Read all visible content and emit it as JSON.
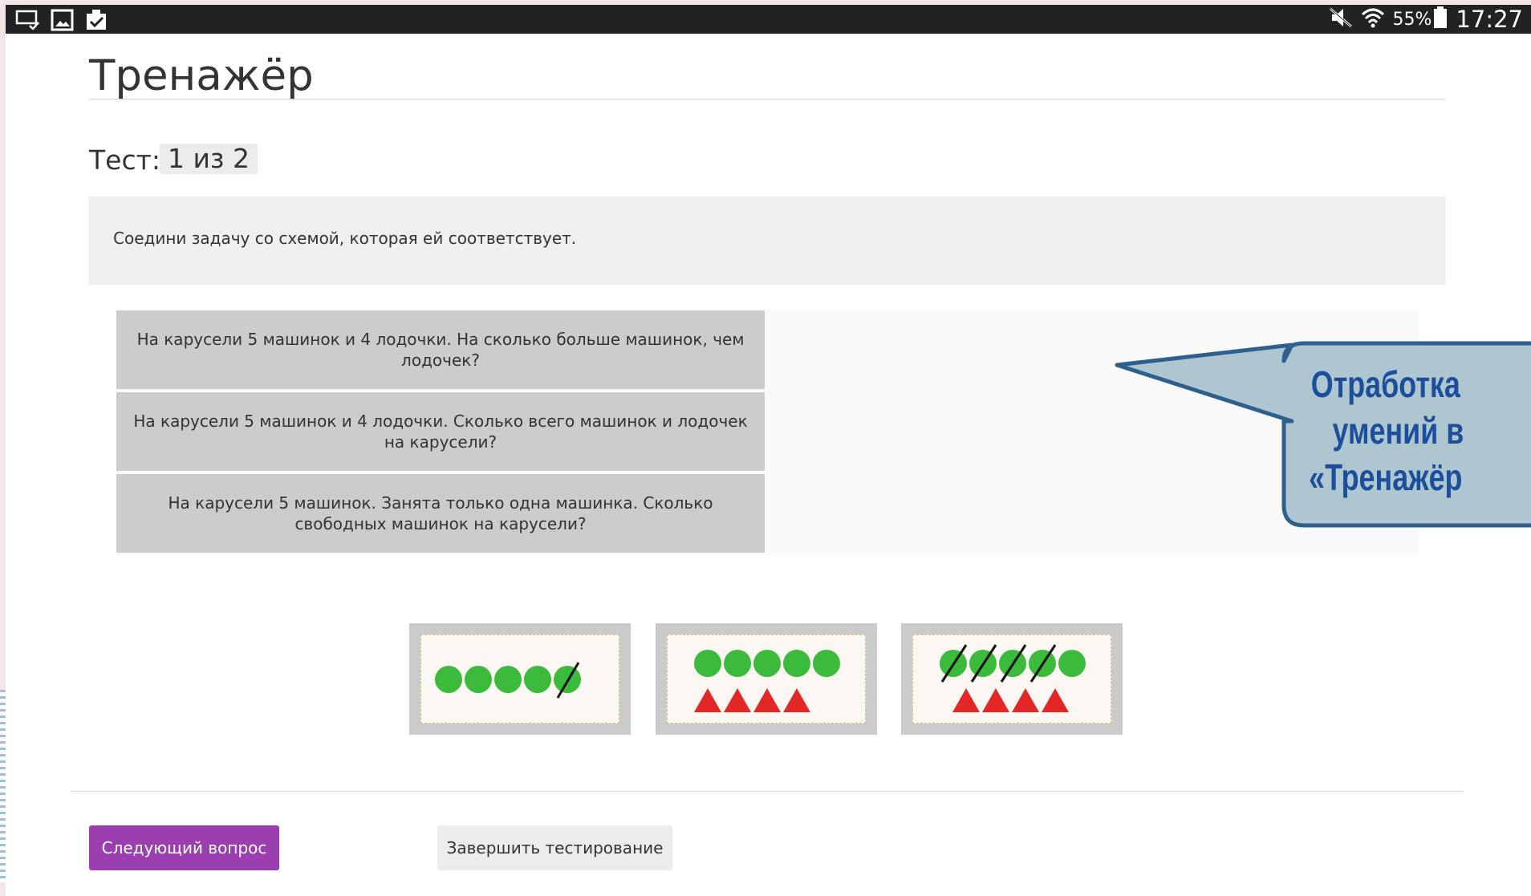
{
  "status_bar": {
    "left_icons": [
      "screen-mirror-icon",
      "gallery-icon",
      "clipboard-check-icon"
    ],
    "right_icons": [
      "mute-icon",
      "wifi-icon",
      "battery-icon"
    ],
    "battery_percent": "55%",
    "time": "17:27"
  },
  "page": {
    "title": "Тренажёр",
    "test_label": "Тест:",
    "test_counter": "1 из 2",
    "instruction": "Соедини задачу со схемой, которая ей соответствует."
  },
  "questions": [
    {
      "text": "На карусели 5 машинок и 4 лодочки. На сколько больше машинок, чем лодочек?"
    },
    {
      "text": "На карусели 5 машинок и 4 лодочки. Сколько всего машинок и лодочек на карусели?"
    },
    {
      "text": "На карусели 5 машинок. Занята только одна машинка. Сколько свободных машинок на карусели?"
    }
  ],
  "schemes": [
    {
      "circles": 5,
      "crossed_circles": 1,
      "triangles": 0
    },
    {
      "circles": 5,
      "crossed_circles": 0,
      "triangles": 4
    },
    {
      "circles": 5,
      "crossed_circles": 4,
      "triangles": 4
    }
  ],
  "colors": {
    "circle": "#3cba3c",
    "triangle": "#e32626",
    "primary_button": "#9b3fb0",
    "callout_fill": "#aec6cf",
    "callout_border": "#2f5f8f",
    "callout_text": "#1b4e9b"
  },
  "buttons": {
    "next": "Следующий вопрос",
    "finish": "Завершить тестирование"
  },
  "callout": {
    "lines": [
      "Отработка",
      "умений в",
      "«Тренажёр"
    ]
  }
}
